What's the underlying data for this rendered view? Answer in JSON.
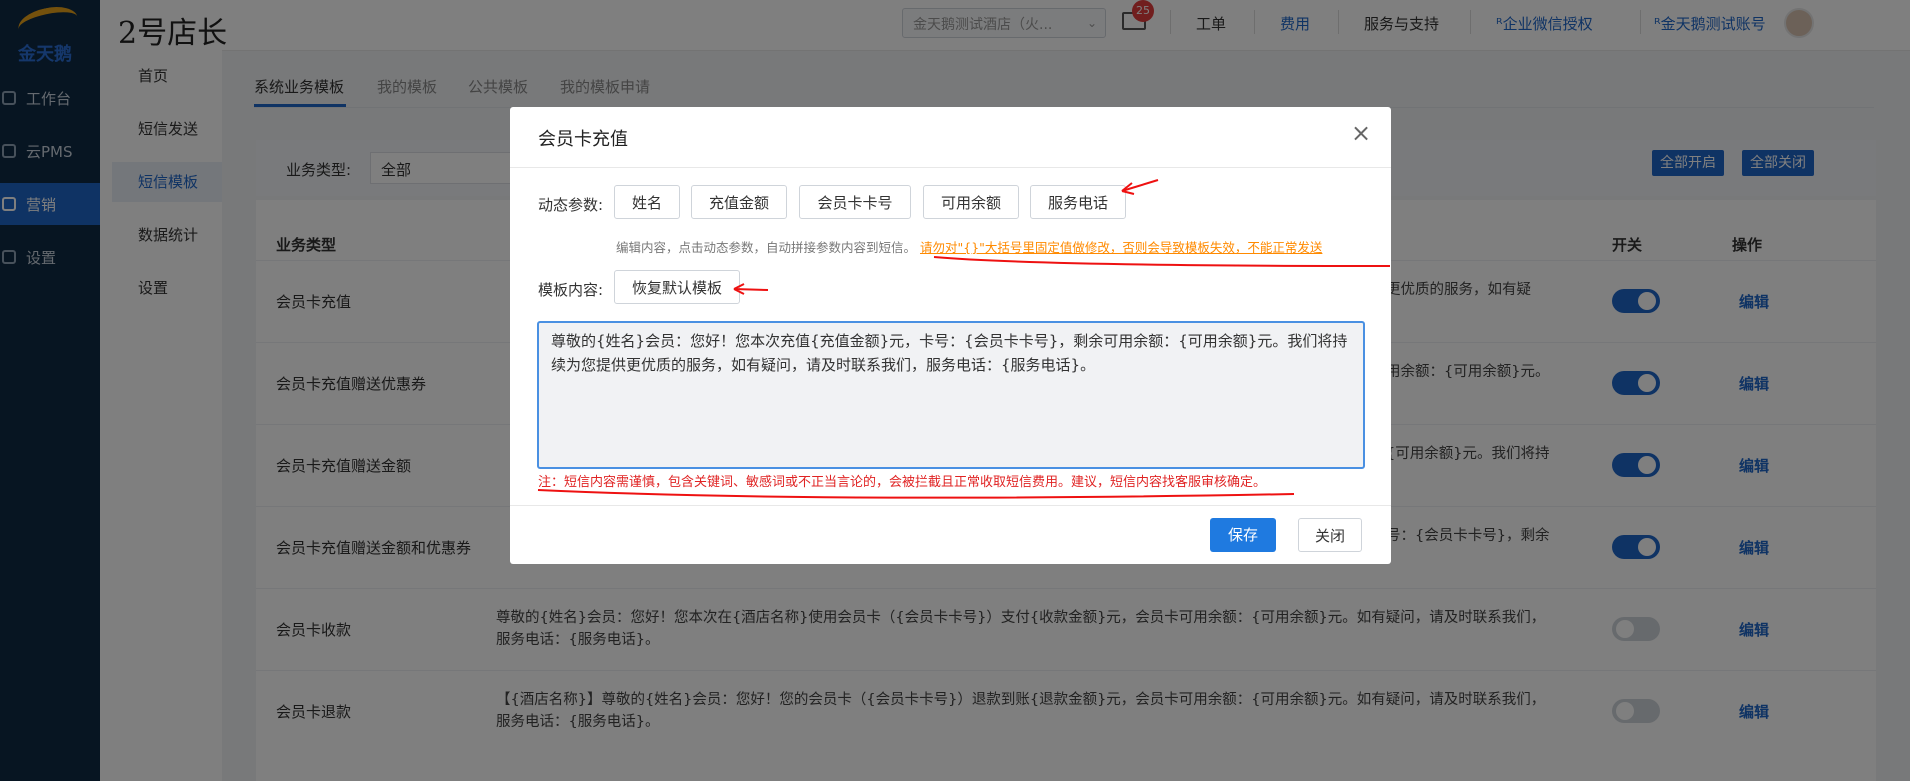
{
  "brand": {
    "logo_text": "金天鹅",
    "app_title": "2号店长"
  },
  "nav": {
    "items": [
      {
        "label": "工作台",
        "icon": "workbench-icon"
      },
      {
        "label": "云PMS",
        "icon": "gear-icon"
      },
      {
        "label": "营销",
        "icon": "marketing-icon",
        "active": true
      },
      {
        "label": "设置",
        "icon": "gear-icon"
      }
    ]
  },
  "topbar": {
    "hotel": "金天鹅测试酒店（火...",
    "notifications": "25",
    "links": [
      "工单",
      "费用",
      "服务与支持",
      "企业微信授权",
      "金天鹅测试账号"
    ]
  },
  "subnav": {
    "items": [
      "首页",
      "短信发送",
      "短信模板",
      "数据统计",
      "设置"
    ]
  },
  "tabs": [
    "系统业务模板",
    "我的模板",
    "公共模板",
    "我的模板申请"
  ],
  "filter": {
    "label": "业务类型:",
    "value": "全部",
    "enable_all": "全部开启",
    "disable_all": "全部关闭"
  },
  "table": {
    "headers": {
      "biz": "业务类型",
      "toggle": "开关",
      "op": "操作"
    },
    "edit_label": "编辑",
    "rows": [
      {
        "biz": "会员卡充值",
        "tpl": "更优质的服务，如有疑",
        "on": true
      },
      {
        "biz": "会员卡充值赠送优惠券",
        "tpl": "用余额：{可用余额}元。",
        "on": true
      },
      {
        "biz": "会员卡充值赠送金额",
        "tpl": "{可用余额}元。我们将持",
        "on": true
      },
      {
        "biz": "会员卡充值赠送金额和优惠券",
        "tpl": "号：{会员卡卡号}，剩余",
        "on": true
      },
      {
        "biz": "会员卡收款",
        "tpl": "尊敬的{姓名}会员：您好！您本次在{酒店名称}使用会员卡（{会员卡卡号}）支付{收款金额}元，会员卡可用余额：{可用余额}元。如有疑问，请及时联系我们，服务电话：{服务电话}。",
        "on": false
      },
      {
        "biz": "会员卡退款",
        "tpl": "【{酒店名称}】尊敬的{姓名}会员：您好！您的会员卡（{会员卡卡号}）退款到账{退款金额}元，会员卡可用余额：{可用余额}元。如有疑问，请及时联系我们，服务电话：{服务电话}。",
        "on": false
      }
    ]
  },
  "modal": {
    "title": "会员卡充值",
    "params_label": "动态参数:",
    "params": [
      "姓名",
      "充值金额",
      "会员卡卡号",
      "可用余额",
      "服务电话"
    ],
    "hint": "编辑内容，点击动态参数，自动拼接参数内容到短信。",
    "warning": "请勿对\"{}\"大括号里固定值做修改，否则会导致模板失效，不能正常发送",
    "content_label": "模板内容:",
    "restore": "恢复默认模板",
    "content": "尊敬的{姓名}会员：您好！您本次充值{充值金额}元，卡号：{会员卡卡号}，剩余可用余额：{可用余额}元。我们将持续为您提供更优质的服务，如有疑问，请及时联系我们，服务电话：{服务电话}。",
    "note": "注：短信内容需谨慎，包含关键词、敏感词或不正当言论的，会被拦截且正常收取短信费用。建议，短信内容找客服审核确定。",
    "save": "保存",
    "close": "关闭"
  },
  "colors": {
    "accent": "#1f66c9",
    "danger": "#e02424",
    "warning": "#ff8a00",
    "nav_bg": "#0f2a44"
  }
}
